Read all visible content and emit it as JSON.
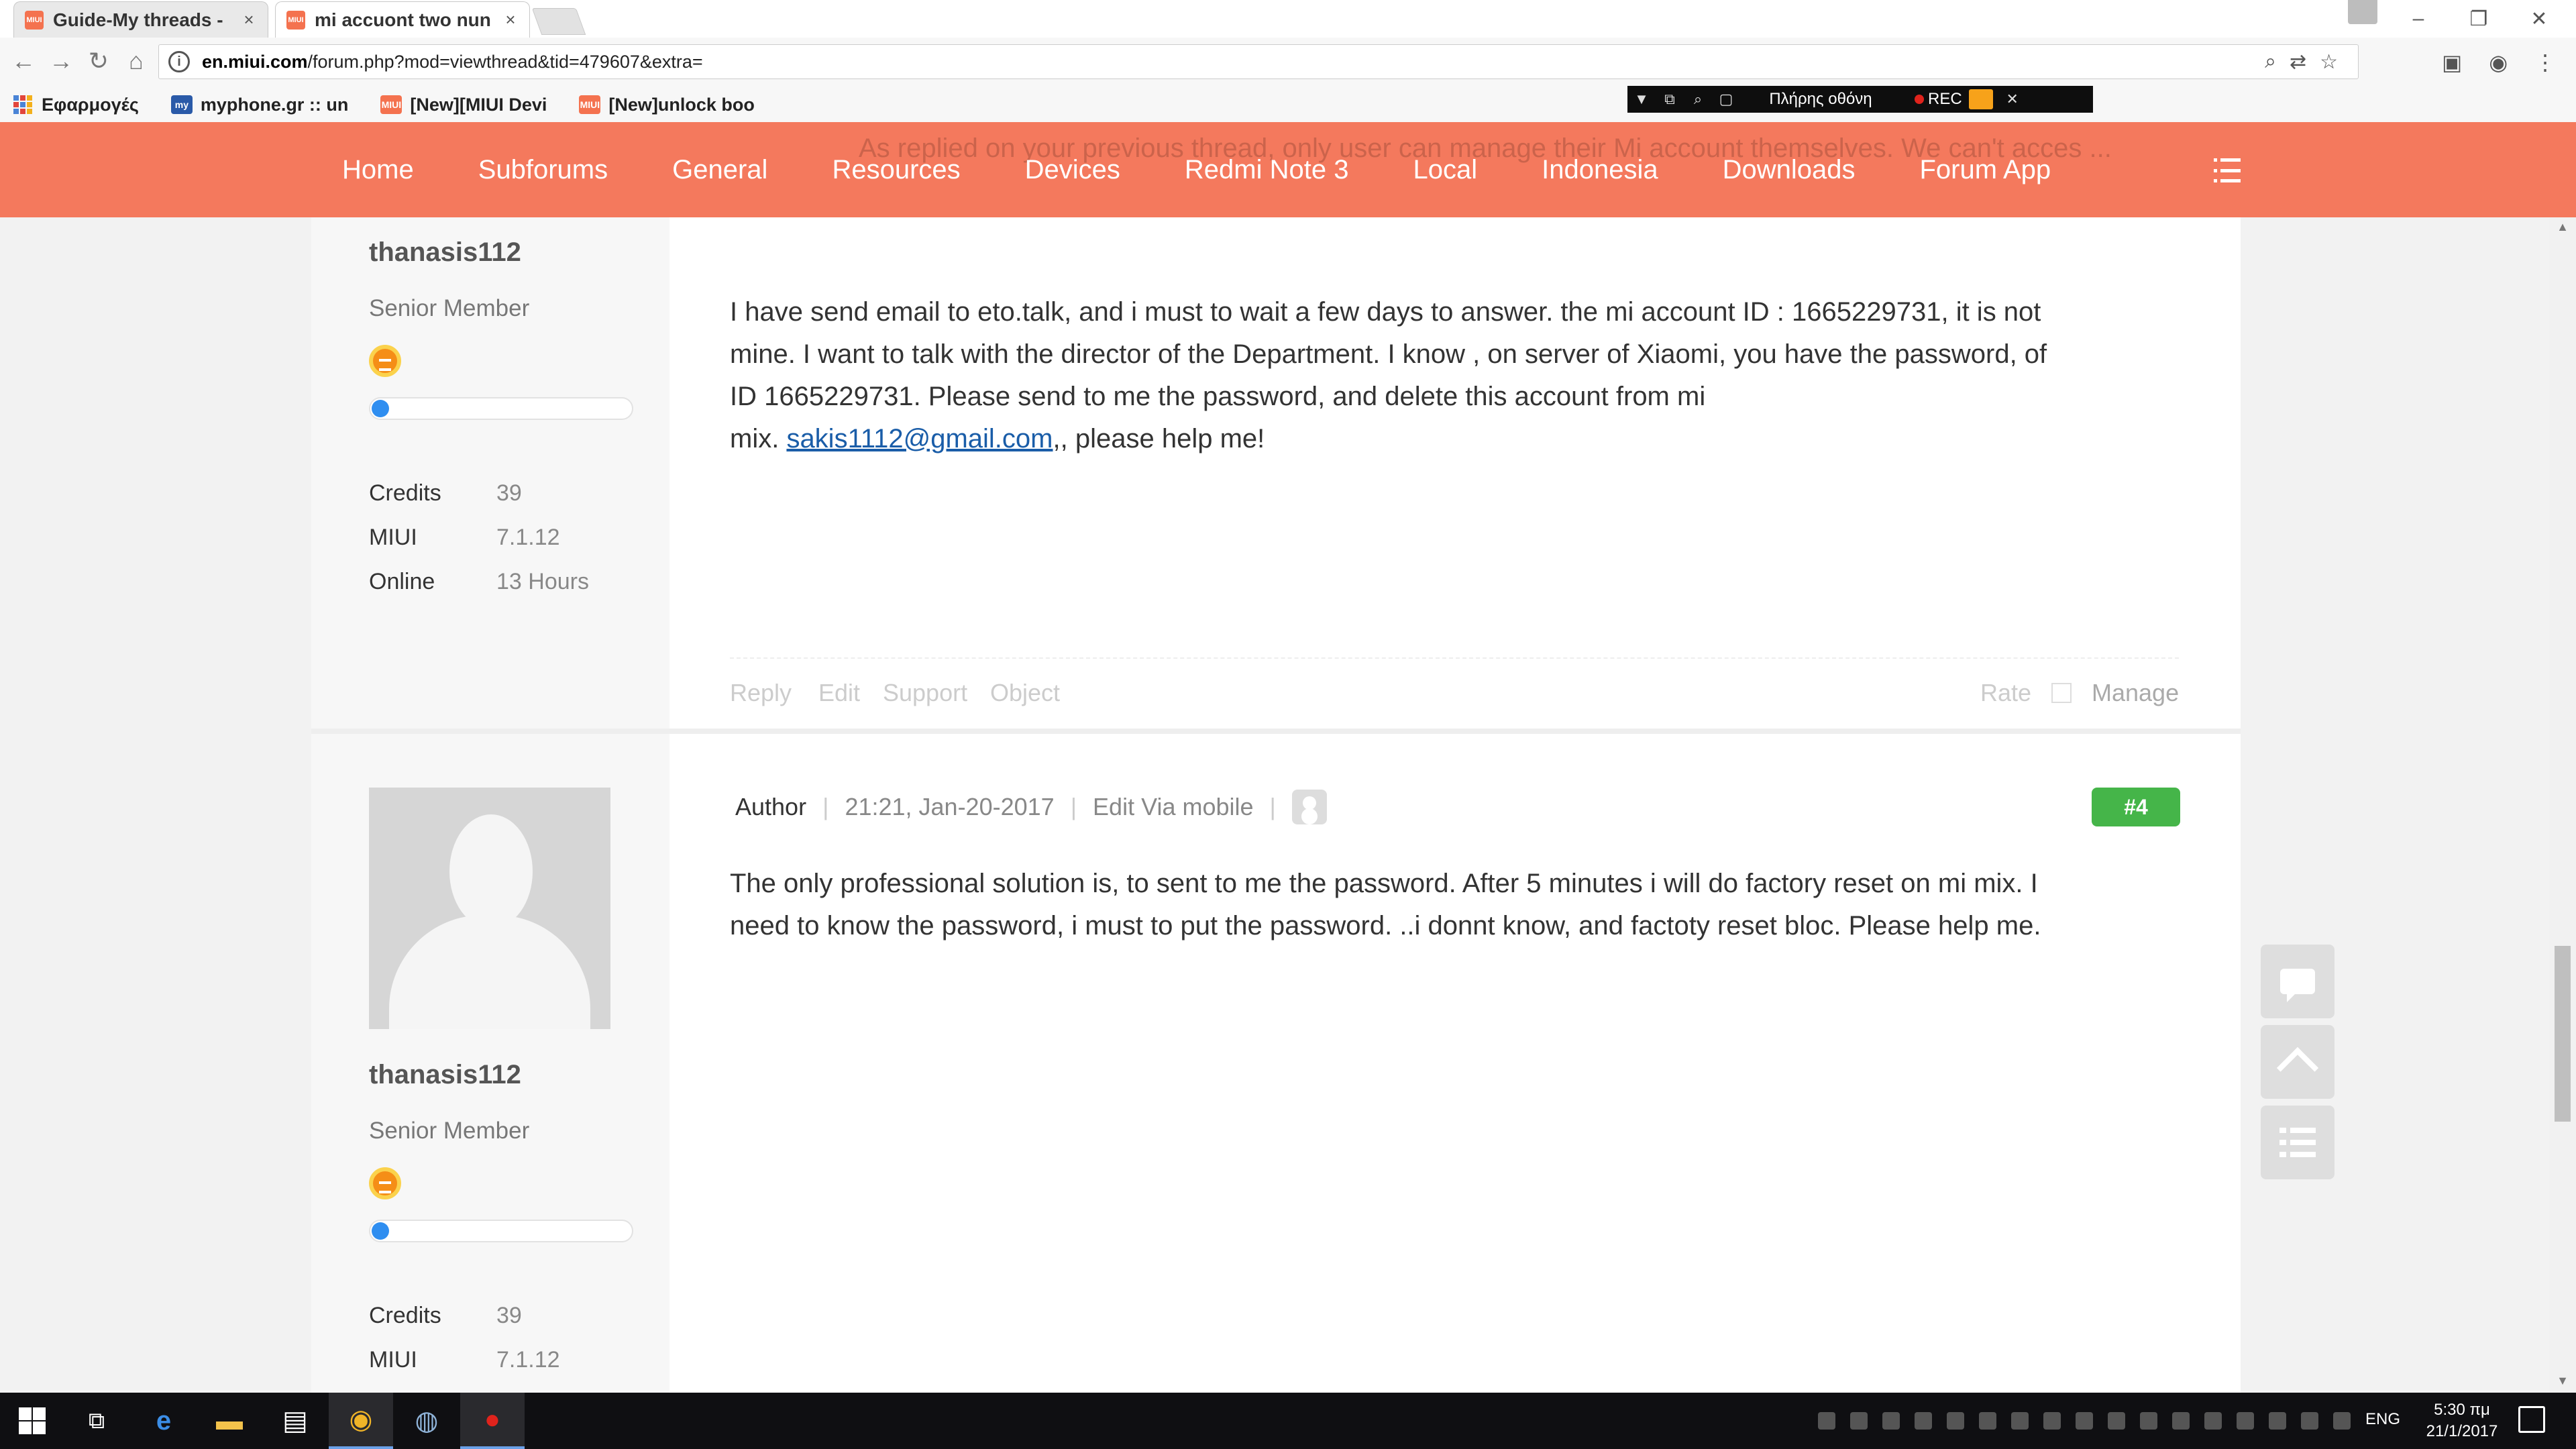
{
  "browser": {
    "tabs": [
      {
        "label": "Guide-My threads -",
        "favicon": "miui-icon",
        "active": false
      },
      {
        "label": "mi accuont two nun",
        "favicon": "miui-icon",
        "active": true
      }
    ],
    "url_host": "en.miui.com",
    "url_path": "/forum.php?mod=viewthread&tid=479607&extra=",
    "bookmarks": [
      {
        "label": "Εφαρμογές",
        "icon": "apps-grid-icon"
      },
      {
        "label": "myphone.gr :: un",
        "icon": "myphone-icon"
      },
      {
        "label": "[New][MIUI Devi",
        "icon": "miui-icon"
      },
      {
        "label": "[New]unlock boo",
        "icon": "miui-icon"
      }
    ],
    "recorder": {
      "fullscreen_label": "Πλήρης οθόνη",
      "rec_label": "REC"
    }
  },
  "nav": {
    "items": [
      "Home",
      "Subforums",
      "General",
      "Resources",
      "Devices",
      "Redmi Note 3",
      "Local",
      "Indonesia",
      "Downloads",
      "Forum App"
    ],
    "ghost_text": "As replied on your previous thread, only user can manage their Mi account themselves. We can't acces ...",
    "accent": "#f4795d"
  },
  "post3": {
    "username": "thanasis112",
    "rank": "Senior Member",
    "stats": [
      {
        "label": "Credits",
        "value": "39"
      },
      {
        "label": "MIUI",
        "value": "7.1.12"
      },
      {
        "label": "Online",
        "value": "13 Hours"
      }
    ],
    "body_line1": "I have send  email   to  eto.talk,  and i must to wait a few days to answer.  the mi account ID : 1665229731, it is not",
    "body_line2": "mine. I want to talk with the director of the  Department.  I know  , on server of Xiaomi,  you have the password,  of",
    "body_line3": "ID 1665229731.  Please  send to me the password,  and delete  this account from mi",
    "body_line4_pre": "mix.  ",
    "email": "sakis1112@gmail.com",
    "body_line4_post": ",,  please  help me!",
    "actions": [
      "Reply",
      "Edit",
      "Support",
      "Object"
    ],
    "rate_label": "Rate",
    "manage_label": "Manage"
  },
  "post4": {
    "username": "thanasis112",
    "rank": "Senior Member",
    "stats": [
      {
        "label": "Credits",
        "value": "39"
      },
      {
        "label": "MIUI",
        "value": "7.1.12"
      }
    ],
    "author_label": "Author",
    "timestamp": "21:21, Jan-20-2017",
    "via": "Edit Via mobile",
    "floor": "#4",
    "floor_color": "#45b549",
    "body_line1": "The only professional solution is,  to sent to me the password. After 5 minutes i will do factory reset on mi mix. I",
    "body_line2": "need to know the password,  i must to put the password. ..i donnt know, and factoty reset bloc. Please help me."
  },
  "taskbar": {
    "lang": "ENG",
    "time": "5:30 πμ",
    "date": "21/1/2017"
  }
}
